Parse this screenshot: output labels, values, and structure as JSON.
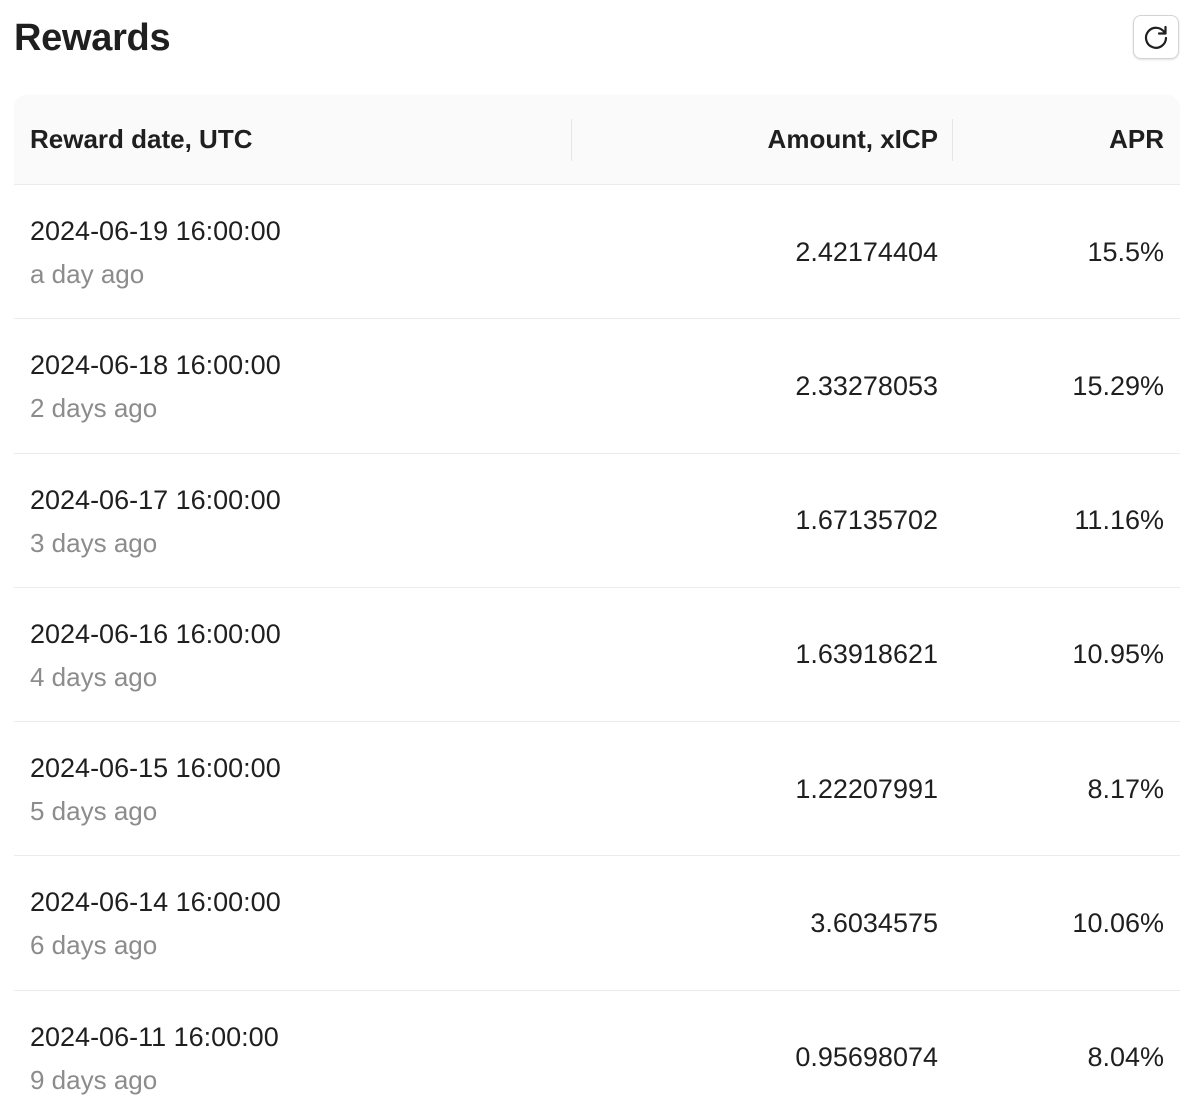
{
  "header": {
    "title": "Rewards",
    "refresh_icon": "refresh-icon"
  },
  "table": {
    "columns": {
      "date": "Reward date, UTC",
      "amount": "Amount, xICP",
      "apr": "APR"
    },
    "rows": [
      {
        "date": "2024-06-19 16:00:00",
        "relative": "a day ago",
        "amount": "2.42174404",
        "apr": "15.5%"
      },
      {
        "date": "2024-06-18 16:00:00",
        "relative": "2 days ago",
        "amount": "2.33278053",
        "apr": "15.29%"
      },
      {
        "date": "2024-06-17 16:00:00",
        "relative": "3 days ago",
        "amount": "1.67135702",
        "apr": "11.16%"
      },
      {
        "date": "2024-06-16 16:00:00",
        "relative": "4 days ago",
        "amount": "1.63918621",
        "apr": "10.95%"
      },
      {
        "date": "2024-06-15 16:00:00",
        "relative": "5 days ago",
        "amount": "1.22207991",
        "apr": "8.17%"
      },
      {
        "date": "2024-06-14 16:00:00",
        "relative": "6 days ago",
        "amount": "3.6034575",
        "apr": "10.06%"
      },
      {
        "date": "2024-06-11 16:00:00",
        "relative": "9 days ago",
        "amount": "0.95698074",
        "apr": "8.04%"
      }
    ]
  }
}
